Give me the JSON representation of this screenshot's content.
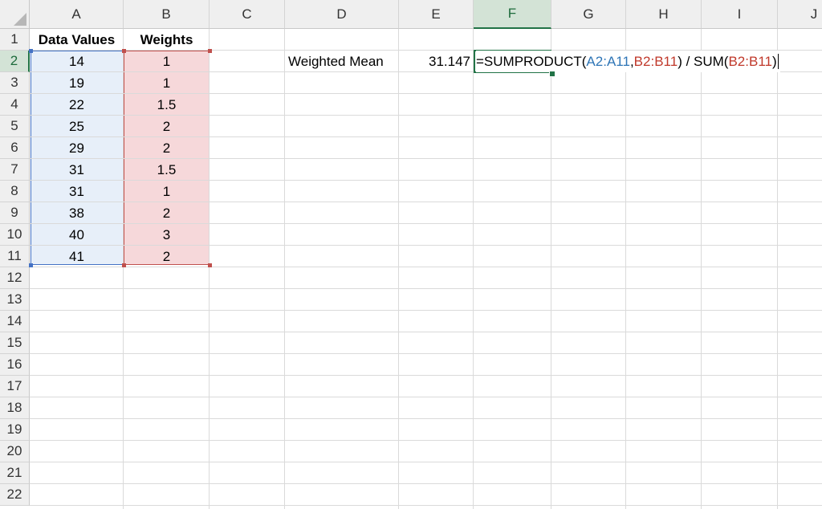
{
  "grid": {
    "columns": [
      "A",
      "B",
      "C",
      "D",
      "E",
      "F",
      "G",
      "H",
      "I",
      "J"
    ],
    "active_column": "F",
    "rows": [
      "1",
      "2",
      "3",
      "4",
      "5",
      "6",
      "7",
      "8",
      "9",
      "10",
      "11",
      "12",
      "13",
      "14",
      "15",
      "16",
      "17",
      "18",
      "19",
      "20",
      "21",
      "22"
    ],
    "active_row": "2"
  },
  "headers": {
    "data_values": "Data Values",
    "weights": "Weights"
  },
  "data_values": [
    "14",
    "19",
    "22",
    "25",
    "29",
    "31",
    "31",
    "38",
    "40",
    "41"
  ],
  "weights": [
    "1",
    "1",
    "1.5",
    "2",
    "2",
    "1.5",
    "1",
    "2",
    "3",
    "2"
  ],
  "summary": {
    "label": "Weighted Mean",
    "value": "31.147"
  },
  "formula": {
    "prefix": "=SUMPRODUCT(",
    "range_a": "A2:A11",
    "sep": ", ",
    "range_b": "B2:B11",
    "mid": ") / SUM(",
    "range_b2": "B2:B11",
    "suffix": ")"
  },
  "colors": {
    "range_a": "#2e75b6",
    "range_b": "#c0392b",
    "active": "#217346"
  }
}
